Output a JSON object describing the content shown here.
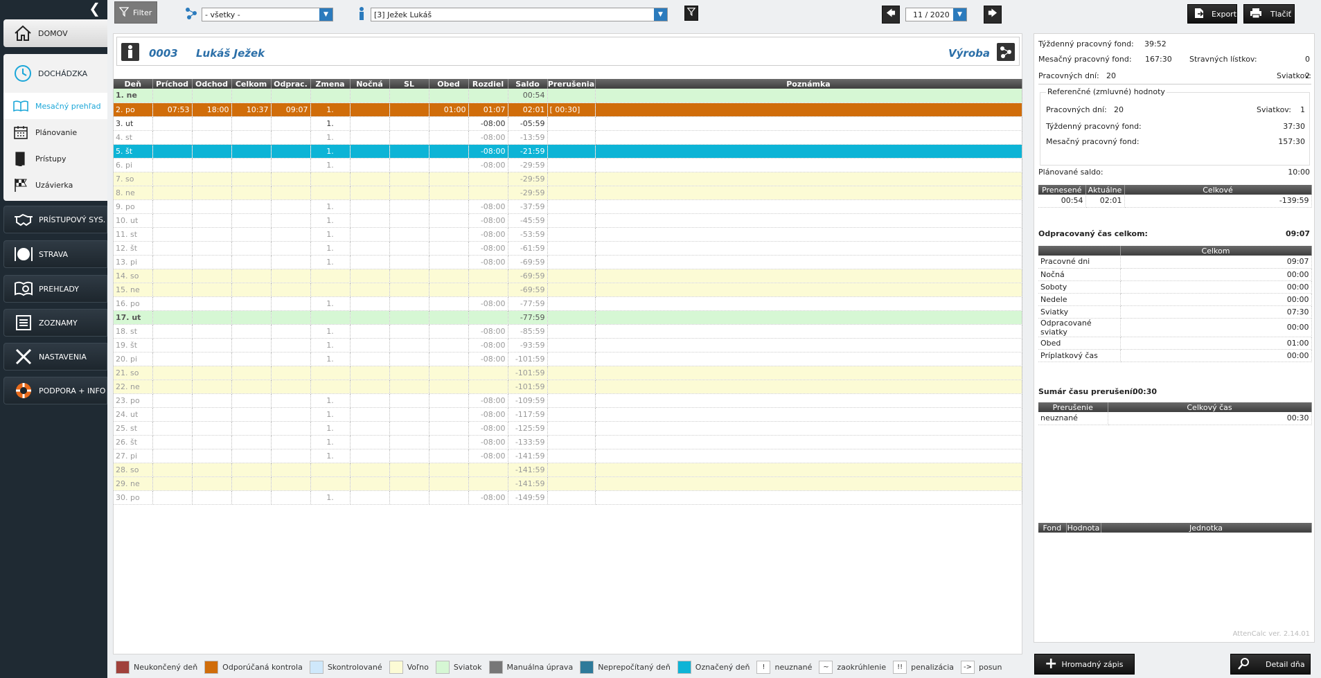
{
  "nav": {
    "domov": "DOMOV",
    "dochadzka": "DOCHÁDZKA",
    "sub": [
      "Mesačný prehľad",
      "Plánovanie",
      "Prístupy",
      "Uzávierka"
    ],
    "pristupovy": "PRÍSTUPOVÝ SYS.",
    "strava": "STRAVA",
    "prehlady": "PREHĽADY",
    "zoznamy": "ZOZNAMY",
    "nastavenia": "NASTAVENIA",
    "podpora": "PODPORA + INFO"
  },
  "toolbar": {
    "filter_label": "Filter",
    "group_value": "- všetky -",
    "person_value": "[3] Ježek Lukáš",
    "period_value": "11 / 2020",
    "export_label": "Export",
    "print_label": "Tlačiť"
  },
  "employee": {
    "number": "0003",
    "name": "Lukáš Ježek",
    "department": "Výroba"
  },
  "table": {
    "headers": [
      "Deň",
      "Príchod",
      "Odchod",
      "Celkom",
      "Odprac.",
      "Zmena",
      "Nočná",
      "SL",
      "Obed",
      "Rozdiel",
      "Saldo",
      "Prerušenia",
      "Poznámka"
    ],
    "rows": [
      {
        "t": "hol",
        "c": [
          "1. ne",
          "",
          "",
          "",
          "",
          "",
          "",
          "",
          "",
          "",
          "00:54",
          "",
          ""
        ]
      },
      {
        "t": "ctl",
        "c": [
          "2. po",
          "07:53",
          "18:00",
          "10:37",
          "09:07",
          "1.",
          "",
          "",
          "01:00",
          "01:07",
          "02:01",
          "[ 00:30]",
          ""
        ]
      },
      {
        "t": "cur",
        "c": [
          "3. ut",
          "",
          "",
          "",
          "",
          "1.",
          "",
          "",
          "",
          "-08:00",
          "-05:59",
          "",
          ""
        ]
      },
      {
        "t": "",
        "c": [
          "4. st",
          "",
          "",
          "",
          "",
          "1.",
          "",
          "",
          "",
          "-08:00",
          "-13:59",
          "",
          ""
        ]
      },
      {
        "t": "sel",
        "c": [
          "5. št",
          "",
          "",
          "",
          "",
          "1.",
          "",
          "",
          "",
          "-08:00",
          "-21:59",
          "",
          ""
        ]
      },
      {
        "t": "",
        "c": [
          "6. pi",
          "",
          "",
          "",
          "",
          "1.",
          "",
          "",
          "",
          "-08:00",
          "-29:59",
          "",
          ""
        ]
      },
      {
        "t": "we",
        "c": [
          "7. so",
          "",
          "",
          "",
          "",
          "",
          "",
          "",
          "",
          "",
          "-29:59",
          "",
          ""
        ]
      },
      {
        "t": "we",
        "c": [
          "8. ne",
          "",
          "",
          "",
          "",
          "",
          "",
          "",
          "",
          "",
          "-29:59",
          "",
          ""
        ]
      },
      {
        "t": "",
        "c": [
          "9. po",
          "",
          "",
          "",
          "",
          "1.",
          "",
          "",
          "",
          "-08:00",
          "-37:59",
          "",
          ""
        ]
      },
      {
        "t": "",
        "c": [
          "10. ut",
          "",
          "",
          "",
          "",
          "1.",
          "",
          "",
          "",
          "-08:00",
          "-45:59",
          "",
          ""
        ]
      },
      {
        "t": "",
        "c": [
          "11. st",
          "",
          "",
          "",
          "",
          "1.",
          "",
          "",
          "",
          "-08:00",
          "-53:59",
          "",
          ""
        ]
      },
      {
        "t": "",
        "c": [
          "12. št",
          "",
          "",
          "",
          "",
          "1.",
          "",
          "",
          "",
          "-08:00",
          "-61:59",
          "",
          ""
        ]
      },
      {
        "t": "",
        "c": [
          "13. pi",
          "",
          "",
          "",
          "",
          "1.",
          "",
          "",
          "",
          "-08:00",
          "-69:59",
          "",
          ""
        ]
      },
      {
        "t": "we",
        "c": [
          "14. so",
          "",
          "",
          "",
          "",
          "",
          "",
          "",
          "",
          "",
          "-69:59",
          "",
          ""
        ]
      },
      {
        "t": "we",
        "c": [
          "15. ne",
          "",
          "",
          "",
          "",
          "",
          "",
          "",
          "",
          "",
          "-69:59",
          "",
          ""
        ]
      },
      {
        "t": "",
        "c": [
          "16. po",
          "",
          "",
          "",
          "",
          "1.",
          "",
          "",
          "",
          "-08:00",
          "-77:59",
          "",
          ""
        ]
      },
      {
        "t": "hol",
        "c": [
          "17. ut",
          "",
          "",
          "",
          "",
          "",
          "",
          "",
          "",
          "",
          "-77:59",
          "",
          ""
        ]
      },
      {
        "t": "",
        "c": [
          "18. st",
          "",
          "",
          "",
          "",
          "1.",
          "",
          "",
          "",
          "-08:00",
          "-85:59",
          "",
          ""
        ]
      },
      {
        "t": "",
        "c": [
          "19. št",
          "",
          "",
          "",
          "",
          "1.",
          "",
          "",
          "",
          "-08:00",
          "-93:59",
          "",
          ""
        ]
      },
      {
        "t": "",
        "c": [
          "20. pi",
          "",
          "",
          "",
          "",
          "1.",
          "",
          "",
          "",
          "-08:00",
          "-101:59",
          "",
          ""
        ]
      },
      {
        "t": "we",
        "c": [
          "21. so",
          "",
          "",
          "",
          "",
          "",
          "",
          "",
          "",
          "",
          "-101:59",
          "",
          ""
        ]
      },
      {
        "t": "we",
        "c": [
          "22. ne",
          "",
          "",
          "",
          "",
          "",
          "",
          "",
          "",
          "",
          "-101:59",
          "",
          ""
        ]
      },
      {
        "t": "",
        "c": [
          "23. po",
          "",
          "",
          "",
          "",
          "1.",
          "",
          "",
          "",
          "-08:00",
          "-109:59",
          "",
          ""
        ]
      },
      {
        "t": "",
        "c": [
          "24. ut",
          "",
          "",
          "",
          "",
          "1.",
          "",
          "",
          "",
          "-08:00",
          "-117:59",
          "",
          ""
        ]
      },
      {
        "t": "",
        "c": [
          "25. st",
          "",
          "",
          "",
          "",
          "1.",
          "",
          "",
          "",
          "-08:00",
          "-125:59",
          "",
          ""
        ]
      },
      {
        "t": "",
        "c": [
          "26. št",
          "",
          "",
          "",
          "",
          "1.",
          "",
          "",
          "",
          "-08:00",
          "-133:59",
          "",
          ""
        ]
      },
      {
        "t": "",
        "c": [
          "27. pi",
          "",
          "",
          "",
          "",
          "1.",
          "",
          "",
          "",
          "-08:00",
          "-141:59",
          "",
          ""
        ]
      },
      {
        "t": "we",
        "c": [
          "28. so",
          "",
          "",
          "",
          "",
          "",
          "",
          "",
          "",
          "",
          "-141:59",
          "",
          ""
        ]
      },
      {
        "t": "we",
        "c": [
          "29. ne",
          "",
          "",
          "",
          "",
          "",
          "",
          "",
          "",
          "",
          "-141:59",
          "",
          ""
        ]
      },
      {
        "t": "",
        "c": [
          "30. po",
          "",
          "",
          "",
          "",
          "1.",
          "",
          "",
          "",
          "-08:00",
          "-149:59",
          "",
          ""
        ]
      }
    ]
  },
  "summary": {
    "weekly_fund_label": "Týždenný pracovný fond:",
    "weekly_fund": "39:52",
    "monthly_fund_label": "Mesačný pracovný fond:",
    "monthly_fund": "167:30",
    "meal_label": "Stravných lístkov:",
    "meal": "0",
    "workdays_label": "Pracovných dní:",
    "workdays": "20",
    "holidays_label": "Sviatkov:",
    "holidays": "2",
    "ref_title": "Referenčné (zmluvné) hodnoty",
    "ref_workdays_label": "Pracovných dní:",
    "ref_workdays": "20",
    "ref_holidays_label": "Sviatkov:",
    "ref_holidays": "1",
    "ref_weekly_label": "Týždenný pracovný fond:",
    "ref_weekly": "37:30",
    "ref_monthly_label": "Mesačný pracovný fond:",
    "ref_monthly": "157:30",
    "planned_label": "Plánované saldo:",
    "planned": "10:00",
    "saldo_headers": [
      "Prenesené",
      "Aktuálne",
      "Celkové"
    ],
    "saldo_values": [
      "00:54",
      "02:01",
      "-139:59"
    ],
    "worked_label": "Odpracovaný čas celkom:",
    "worked": "09:07",
    "worked_header": "Celkom",
    "worked_rows": [
      [
        "Pracovné dni",
        "09:07"
      ],
      [
        "Nočná",
        "00:00"
      ],
      [
        "Soboty",
        "00:00"
      ],
      [
        "Nedele",
        "00:00"
      ],
      [
        "Sviatky",
        "07:30"
      ],
      [
        "Odpracované sviatky",
        "00:00"
      ],
      [
        "Obed",
        "01:00"
      ],
      [
        "Príplatkový čas",
        "00:00"
      ]
    ],
    "break_label": "Sumár času prerušení:",
    "break": "00:30",
    "break_headers": [
      "Prerušenie",
      "Celkový čas"
    ],
    "break_rows": [
      [
        "neuznané",
        "00:30"
      ]
    ],
    "fund_headers": [
      "Fond",
      "Hodnota",
      "Jednotka"
    ],
    "version": "AttenCalc ver. 2.14.01"
  },
  "legend": [
    {
      "label": "Neukončený deň",
      "color": "#a0413b",
      "sym": ""
    },
    {
      "label": "Odporúčaná kontrola",
      "color": "#d06d0a",
      "sym": ""
    },
    {
      "label": "Skontrolované",
      "color": "#cfe8fb",
      "sym": ""
    },
    {
      "label": "Voľno",
      "color": "#fcfbd5",
      "sym": ""
    },
    {
      "label": "Sviatok",
      "color": "#d6f7d4",
      "sym": ""
    },
    {
      "label": "Manuálna úprava",
      "color": "#777777",
      "sym": ""
    },
    {
      "label": "Neprepočítaný deň",
      "color": "#2e7a9a",
      "sym": ""
    },
    {
      "label": "Označený deň",
      "color": "#0db4d6",
      "sym": ""
    },
    {
      "label": "neuznané",
      "color": "#ffffff",
      "sym": "!"
    },
    {
      "label": "zaokrúhlenie",
      "color": "#ffffff",
      "sym": "~"
    },
    {
      "label": "penalizácia",
      "color": "#ffffff",
      "sym": "!!"
    },
    {
      "label": "posun",
      "color": "#ffffff",
      "sym": "->"
    }
  ],
  "bottom": {
    "bulk_label": "Hromadný zápis",
    "detail_label": "Detail dňa"
  }
}
